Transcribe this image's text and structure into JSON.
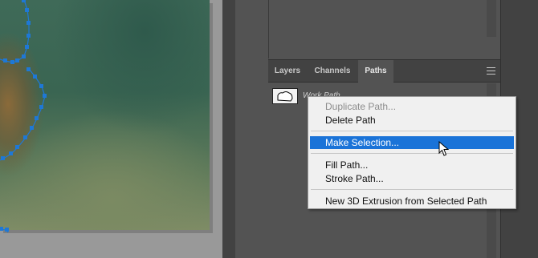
{
  "panel": {
    "tabs": [
      {
        "label": "Layers",
        "active": false
      },
      {
        "label": "Channels",
        "active": false
      },
      {
        "label": "Paths",
        "active": true
      }
    ],
    "menu_icon": "hamburger-menu-icon"
  },
  "paths": {
    "items": [
      {
        "label": "Work Path",
        "thumbnail": "path-thumbnail"
      }
    ]
  },
  "context_menu": {
    "items": [
      {
        "label": "Duplicate Path...",
        "state": "disabled"
      },
      {
        "label": "Delete Path",
        "state": "normal"
      },
      {
        "label": "Make Selection...",
        "state": "highlighted"
      },
      {
        "label": "Fill Path...",
        "state": "normal"
      },
      {
        "label": "Stroke Path...",
        "state": "normal"
      },
      {
        "label": "New 3D Extrusion from Selected Path",
        "state": "normal"
      }
    ]
  },
  "colors": {
    "highlight": "#1a73d8",
    "path_anchor": "#1e78d6",
    "panel_bg": "#535353"
  }
}
